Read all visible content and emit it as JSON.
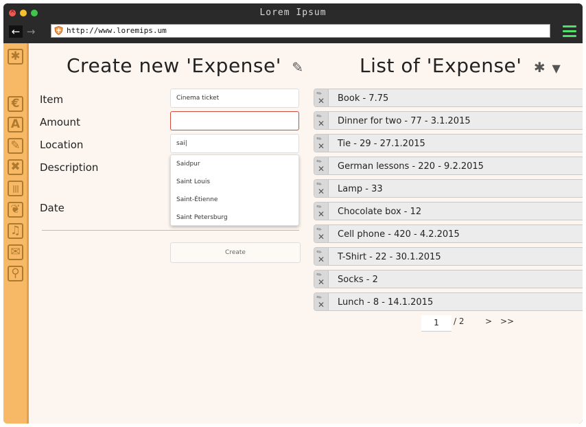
{
  "window": {
    "title": "Lorem Ipsum"
  },
  "browser": {
    "url": "http://www.loremips.um",
    "back_glyph": "←",
    "forward_glyph": "→"
  },
  "sidebar": {
    "items": [
      {
        "glyph": "✱",
        "icon": "asterisk-icon"
      },
      {
        "glyph": "€",
        "icon": "euro-icon"
      },
      {
        "glyph": "A",
        "icon": "road-icon"
      },
      {
        "glyph": "✎",
        "icon": "pencil-icon"
      },
      {
        "glyph": "✖",
        "icon": "close-icon"
      },
      {
        "glyph": "|||",
        "icon": "barcode-icon"
      },
      {
        "glyph": "❦",
        "icon": "leaf-icon"
      },
      {
        "glyph": "♫",
        "icon": "music-icon"
      },
      {
        "glyph": "✉",
        "icon": "mail-icon"
      },
      {
        "glyph": "⚲",
        "icon": "search-icon"
      }
    ]
  },
  "create_form": {
    "title": "Create new 'Expense'",
    "edit_glyph": "✎",
    "labels": {
      "item": "Item",
      "amount": "Amount",
      "location": "Location",
      "description": "Description",
      "date": "Date"
    },
    "item_value": "Cinema ticket",
    "amount_value": "",
    "location_value": "sai|",
    "location_suggestions": [
      "Saidpur",
      "Saint Louis",
      "Saint-Étienne",
      "Saint Petersburg"
    ],
    "create_label": "Create"
  },
  "expense_list": {
    "title": "List of 'Expense'",
    "settings_glyph": "✱",
    "filter_glyph": "▼",
    "edit_glyph": "✎",
    "delete_glyph": "✕",
    "items": [
      "Book - 7.75",
      "Dinner for two - 77 - 3.1.2015",
      "Tie - 29 - 27.1.2015",
      "German lessons - 220 - 9.2.2015",
      "Lamp - 33",
      "Chocolate box - 12",
      "Cell phone - 420 - 4.2.2015",
      "T-Shirt - 22 - 30.1.2015",
      "Socks - 2",
      "Lunch - 8 - 14.1.2015"
    ],
    "pagination": {
      "current": "1",
      "total": "/ 2",
      "next": ">",
      "last": ">>"
    }
  },
  "colors": {
    "sidebar": "#f8b966",
    "content_bg": "#fdf6f0",
    "error_border": "#d24b3c",
    "menu_green": "#4ee06a"
  }
}
